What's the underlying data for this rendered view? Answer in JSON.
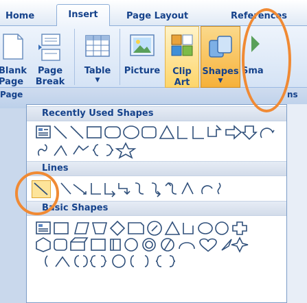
{
  "tabs": [
    {
      "label": "Home",
      "active": false
    },
    {
      "label": "Insert",
      "active": true
    },
    {
      "label": "Page Layout",
      "active": false
    },
    {
      "label": "References",
      "active": false
    }
  ],
  "ribbon": {
    "blank_page": {
      "line1": "Blank",
      "line2": "Page"
    },
    "page_break": {
      "line1": "Page",
      "line2": "Break"
    },
    "table": {
      "label": "Table"
    },
    "picture": {
      "label": "Picture"
    },
    "clip_art": {
      "line1": "Clip",
      "line2": "Art"
    },
    "shapes": {
      "label": "Shapes"
    },
    "next_partial": "Sma",
    "group_left_partial": "Page",
    "group_right_partial": "ns"
  },
  "gallery": {
    "sections": {
      "recent": "Recently Used Shapes",
      "lines": "Lines",
      "basic": "Basic Shapes"
    }
  },
  "colors": {
    "highlight": "#f08a34",
    "accent": "#15428b"
  },
  "icons": [
    "blank-page-icon",
    "page-break-icon",
    "table-icon",
    "picture-icon",
    "clip-art-icon",
    "shapes-icon"
  ]
}
